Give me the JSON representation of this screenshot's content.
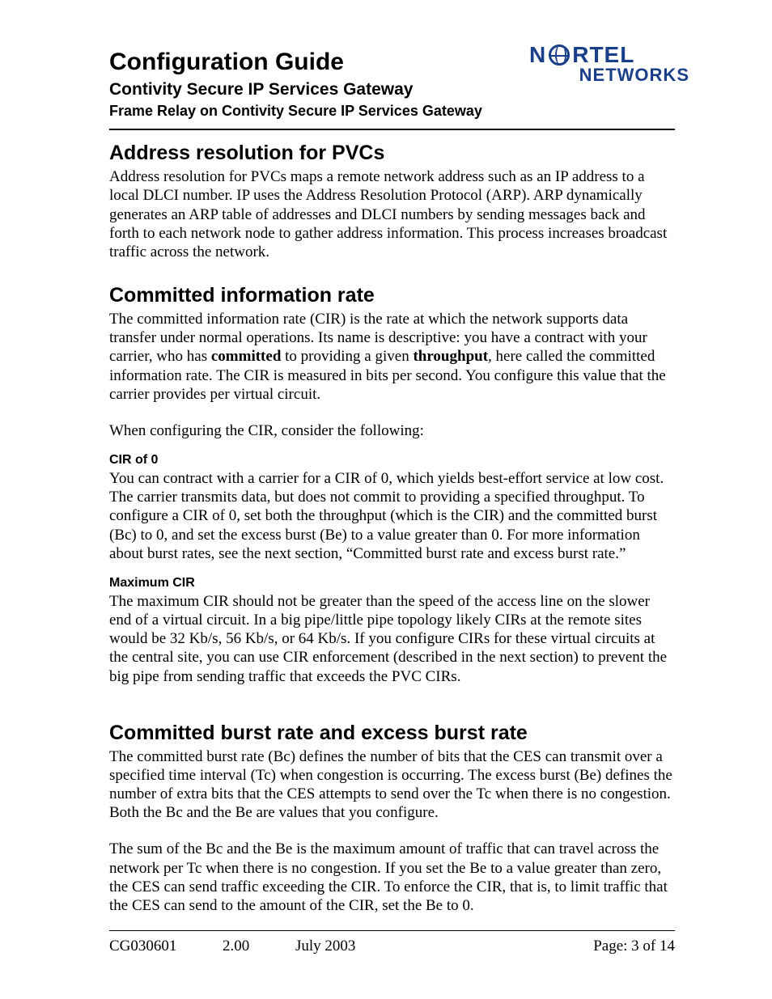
{
  "header": {
    "title": "Configuration Guide",
    "subtitle1": "Contivity Secure IP Services Gateway",
    "subtitle2": "Frame Relay on Contivity Secure IP Services Gateway"
  },
  "logo": {
    "line1_pre": "N",
    "line1_post": "RTEL",
    "line2": "NETWORKS",
    "icon_name": "globe-icon"
  },
  "sections": {
    "s1": {
      "heading": "Address resolution for PVCs",
      "p1": "Address resolution for PVCs maps a remote network address such as an IP address to a local DLCI number.  IP uses the Address Resolution Protocol (ARP). ARP dynamically generates an ARP table of addresses and DLCI numbers by sending messages back and forth to each network node to gather address information. This process increases broadcast traffic across the network."
    },
    "s2": {
      "heading": "Committed information rate",
      "p1_a": "The committed information rate (CIR) is the rate at which the network supports data transfer under normal operations. Its name is descriptive: you have a contract with your carrier, who has ",
      "p1_b_bold": "committed",
      "p1_c": " to providing a given ",
      "p1_d_bold": "throughput",
      "p1_e": ", here called the committed information rate. The CIR is measured in bits per second. You configure this value that the carrier provides per virtual circuit.",
      "p2": "When configuring the CIR, consider the following:",
      "sub1": {
        "heading": "CIR of 0",
        "p": "You can contract with a carrier for a CIR of 0, which yields best-effort service at low cost. The carrier transmits data, but does not commit to providing a specified throughput. To configure a CIR of 0, set both the throughput (which is the CIR) and the committed burst (Bc) to 0, and set the excess burst (Be) to a value greater than 0. For more information about burst rates, see the next section, “Committed burst rate and excess burst rate.”"
      },
      "sub2": {
        "heading": "Maximum CIR",
        "p": "The maximum CIR should not be greater than the speed of the access line on the slower end of a virtual circuit. In a big pipe/little pipe topology likely CIRs at the remote sites would be 32 Kb/s, 56 Kb/s, or 64 Kb/s. If you configure CIRs for these virtual circuits at the central site, you can use CIR enforcement (described in the next section) to prevent the big pipe from sending traffic that exceeds the PVC CIRs."
      }
    },
    "s3": {
      "heading": "Committed burst rate and excess burst rate",
      "p1": "The committed burst rate (Bc) defines the number of bits that the CES can transmit over a specified time interval (Tc) when congestion is occurring. The excess burst (Be) defines the number of extra bits that the CES attempts to send over the Tc when there is no congestion. Both the Bc and the Be are values that you configure.",
      "p2": "The sum of the Bc and the Be is the maximum amount of traffic that can travel across the network per Tc when there is no congestion. If you set the Be to a value greater than zero, the CES can send traffic exceeding the CIR. To enforce the CIR, that is, to limit traffic that the CES can send to the amount of the CIR, set the Be to 0."
    }
  },
  "footer": {
    "doc": "CG030601",
    "version": "2.00",
    "date": "July 2003",
    "page": "Page: 3 of 14"
  }
}
